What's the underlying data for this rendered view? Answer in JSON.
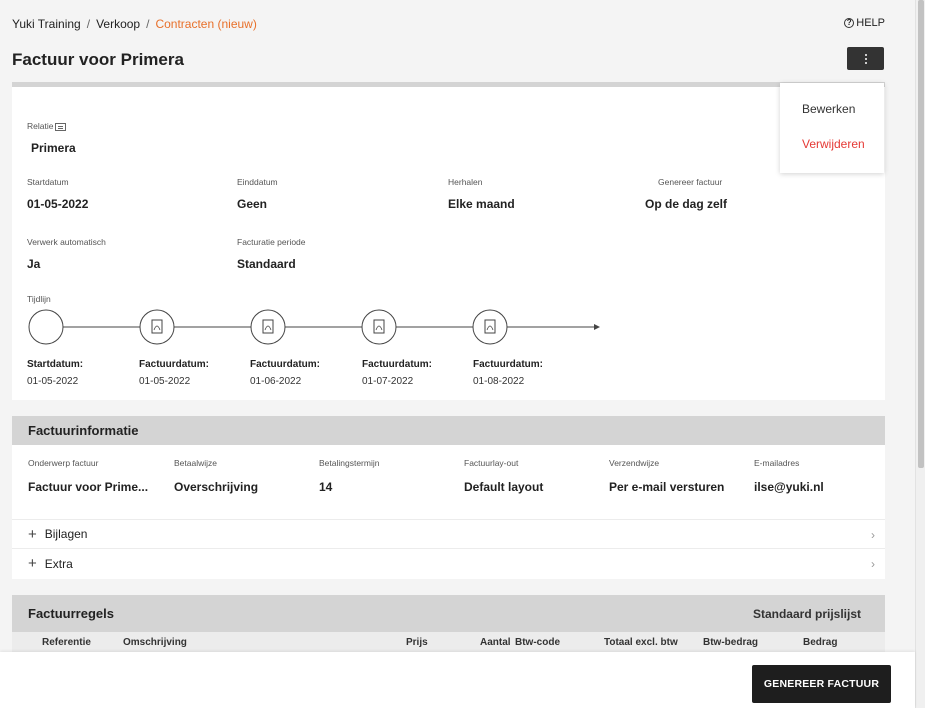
{
  "breadcrumb": {
    "home": "Yuki Training",
    "sep1": "/",
    "section": "Verkoop",
    "sep2": "/",
    "current": "Contracten (nieuw)"
  },
  "help": {
    "label": "HELP"
  },
  "page": {
    "title": "Factuur voor Primera"
  },
  "menu": {
    "edit": "Bewerken",
    "delete": "Verwijderen"
  },
  "contract": {
    "relatie_label": "Relatie",
    "relatie_value": "Primera",
    "startdatum_label": "Startdatum",
    "startdatum_value": "01-05-2022",
    "einddatum_label": "Einddatum",
    "einddatum_value": "Geen",
    "herhalen_label": "Herhalen",
    "herhalen_value": "Elke maand",
    "genereer_label": "Genereer factuur",
    "genereer_value": "Op de dag zelf",
    "verwerk_label": "Verwerk automatisch",
    "verwerk_value": "Ja",
    "periode_label": "Facturatie periode",
    "periode_value": "Standaard",
    "tijdlijn_label": "Tijdlijn"
  },
  "timeline": [
    {
      "label": "Startdatum:",
      "date": "01-05-2022",
      "icon": "circle"
    },
    {
      "label": "Factuurdatum:",
      "date": "01-05-2022",
      "icon": "pdf-icon"
    },
    {
      "label": "Factuurdatum:",
      "date": "01-06-2022",
      "icon": "pdf-icon"
    },
    {
      "label": "Factuurdatum:",
      "date": "01-07-2022",
      "icon": "pdf-icon"
    },
    {
      "label": "Factuurdatum:",
      "date": "01-08-2022",
      "icon": "pdf-icon"
    }
  ],
  "factuurinfo": {
    "title": "Factuurinformatie",
    "onderwerp_label": "Onderwerp factuur",
    "onderwerp_value": "Factuur voor  Prime...",
    "betaalwijze_label": "Betaalwijze",
    "betaalwijze_value": "Overschrijving",
    "termijn_label": "Betalingstermijn",
    "termijn_value": "14",
    "layout_label": "Factuurlay-out",
    "layout_value": "Default layout",
    "verzend_label": "Verzendwijze",
    "verzend_value": "Per e-mail versturen",
    "email_label": "E-mailadres",
    "email_value": "ilse@yuki.nl",
    "bijlagen": "Bijlagen",
    "extra": "Extra"
  },
  "factuurregels": {
    "title": "Factuurregels",
    "pricelist": "Standaard prijslijst",
    "columns": {
      "referentie": "Referentie",
      "omschrijving": "Omschrijving",
      "prijs": "Prijs",
      "aantal": "Aantal",
      "btwcode": "Btw-code",
      "totaal": "Totaal excl. btw",
      "btwbedrag": "Btw-bedrag",
      "bedrag": "Bedrag"
    }
  },
  "footer": {
    "generate": "GENEREER FACTUUR"
  },
  "colors": {
    "accent": "#e8702a",
    "danger": "#e53935",
    "button": "#1e1e1e"
  }
}
